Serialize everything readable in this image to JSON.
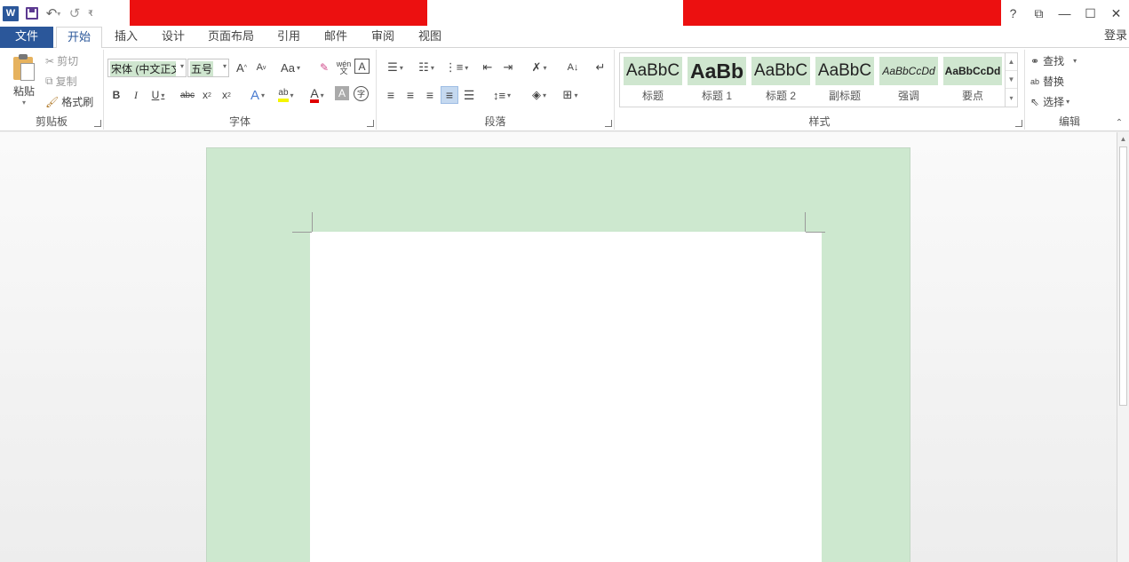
{
  "tabs": [
    "文件",
    "开始",
    "插入",
    "设计",
    "页面布局",
    "引用",
    "邮件",
    "审阅",
    "视图"
  ],
  "login": "登录",
  "window_controls": [
    "?",
    "⧉",
    "—",
    "☐",
    "✕"
  ],
  "clipboard": {
    "paste": "粘贴",
    "cut": "剪切",
    "copy": "复制",
    "format_painter": "格式刷",
    "label": "剪贴板"
  },
  "font": {
    "font_name": "宋体 (中文正文)",
    "font_size": "五号",
    "label": "字体",
    "bold": "B",
    "italic": "I",
    "underline": "U",
    "strike": "abc",
    "case": "Aa",
    "grow": "A",
    "shrink": "A"
  },
  "paragraph": {
    "label": "段落"
  },
  "styles": {
    "label": "样式",
    "items": [
      {
        "preview": "AaBbC",
        "name": "标题"
      },
      {
        "preview": "AaBb",
        "name": "标题 1"
      },
      {
        "preview": "AaBbC",
        "name": "标题 2"
      },
      {
        "preview": "AaBbC",
        "name": "副标题"
      },
      {
        "preview": "AaBbCcDd",
        "name": "强调"
      },
      {
        "preview": "AaBbCcDd",
        "name": "要点"
      }
    ]
  },
  "editing": {
    "find": "查找",
    "replace": "替换",
    "select": "选择",
    "label": "编辑"
  },
  "colors": {
    "accent": "#2b579a",
    "redaction": "#ec1010",
    "page_bg": "#cde8cf"
  }
}
